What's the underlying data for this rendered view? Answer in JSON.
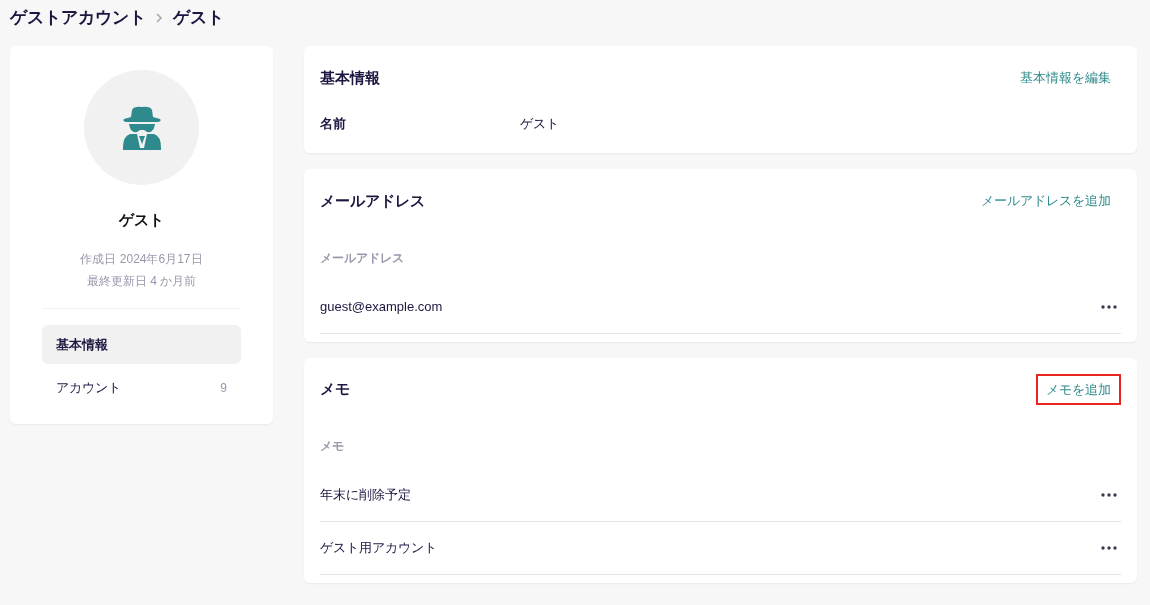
{
  "breadcrumb": [
    {
      "label": "ゲストアカウント"
    },
    {
      "label": "ゲスト"
    }
  ],
  "profile": {
    "name": "ゲスト",
    "created": "作成日 2024年6月17日",
    "updated": "最終更新日 4 か月前"
  },
  "sidebar": {
    "items": [
      {
        "label": "基本情報",
        "selected": true
      },
      {
        "label": "アカウント",
        "count": "9",
        "selected": false
      }
    ]
  },
  "sections": [
    {
      "kind": "fields",
      "title": "基本情報",
      "action": {
        "label": "基本情報を編集",
        "highlighted": false
      },
      "fields": [
        {
          "label": "名前",
          "value": "ゲスト"
        }
      ]
    },
    {
      "kind": "list",
      "title": "メールアドレス",
      "action": {
        "label": "メールアドレスを追加",
        "highlighted": false
      },
      "list_label": "メールアドレス",
      "items": [
        "guest@example.com"
      ]
    },
    {
      "kind": "list",
      "title": "メモ",
      "action": {
        "label": "メモを追加",
        "highlighted": true
      },
      "list_label": "メモ",
      "items": [
        "年末に削除予定",
        "ゲスト用アカウント"
      ]
    }
  ]
}
